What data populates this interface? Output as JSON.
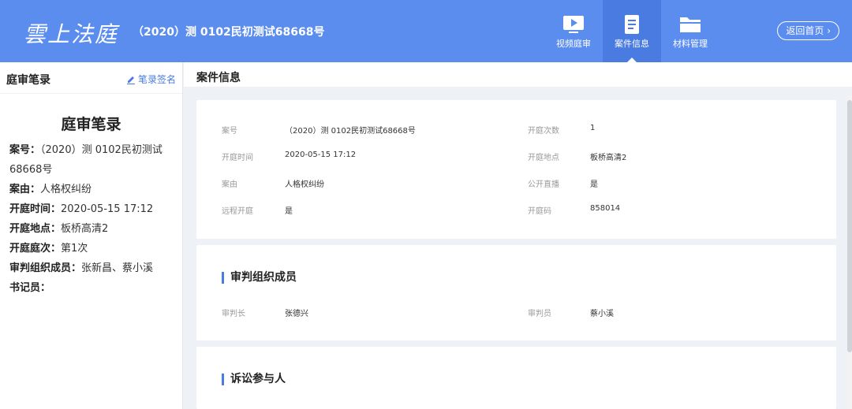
{
  "header": {
    "logo": "雲上法庭",
    "case_title": "（2020）测 0102民初测试68668号",
    "nav": [
      {
        "label": "视频庭审",
        "icon": "video-icon"
      },
      {
        "label": "案件信息",
        "icon": "document-icon",
        "active": true
      },
      {
        "label": "材料管理",
        "icon": "folder-icon"
      }
    ],
    "back_label": "返回首页"
  },
  "left_panel": {
    "title": "庭审笔录",
    "sign_label": "笔录签名",
    "record_title": "庭审笔录",
    "fields": [
      {
        "key": "案号：",
        "value": "（2020）测 0102民初测试68668号"
      },
      {
        "key": "案由：",
        "value": "人格权纠纷"
      },
      {
        "key": "开庭时间：",
        "value": "2020-05-15 17:12"
      },
      {
        "key": "开庭地点：",
        "value": "板桥高清2"
      },
      {
        "key": "开庭庭次：",
        "value": "第1次"
      },
      {
        "key": "审判组织成员：",
        "value": "张新昌、蔡小溪"
      },
      {
        "key": "书记员：",
        "value": ""
      }
    ]
  },
  "main": {
    "title": "案件信息",
    "case_info": {
      "case_no_label": "案号",
      "case_no": "（2020）测 0102民初测试68668号",
      "sessions_label": "开庭次数",
      "sessions": "1",
      "time_label": "开庭时间",
      "time": "2020-05-15 17:12",
      "place_label": "开庭地点",
      "place": "板桥高清2",
      "cause_label": "案由",
      "cause": "人格权纠纷",
      "live_label": "公开直播",
      "live": "是",
      "remote_label": "远程开庭",
      "remote": "是",
      "code_label": "开庭码",
      "code": "858014"
    },
    "judges": {
      "title": "审判组织成员",
      "chief_label": "审判长",
      "chief": "张德兴",
      "judge_label": "审判员",
      "judge": "蔡小溪"
    },
    "participants": {
      "title": "诉讼参与人"
    }
  },
  "colors": {
    "header_bg": "#5b8def",
    "accent": "#4a7be0"
  }
}
